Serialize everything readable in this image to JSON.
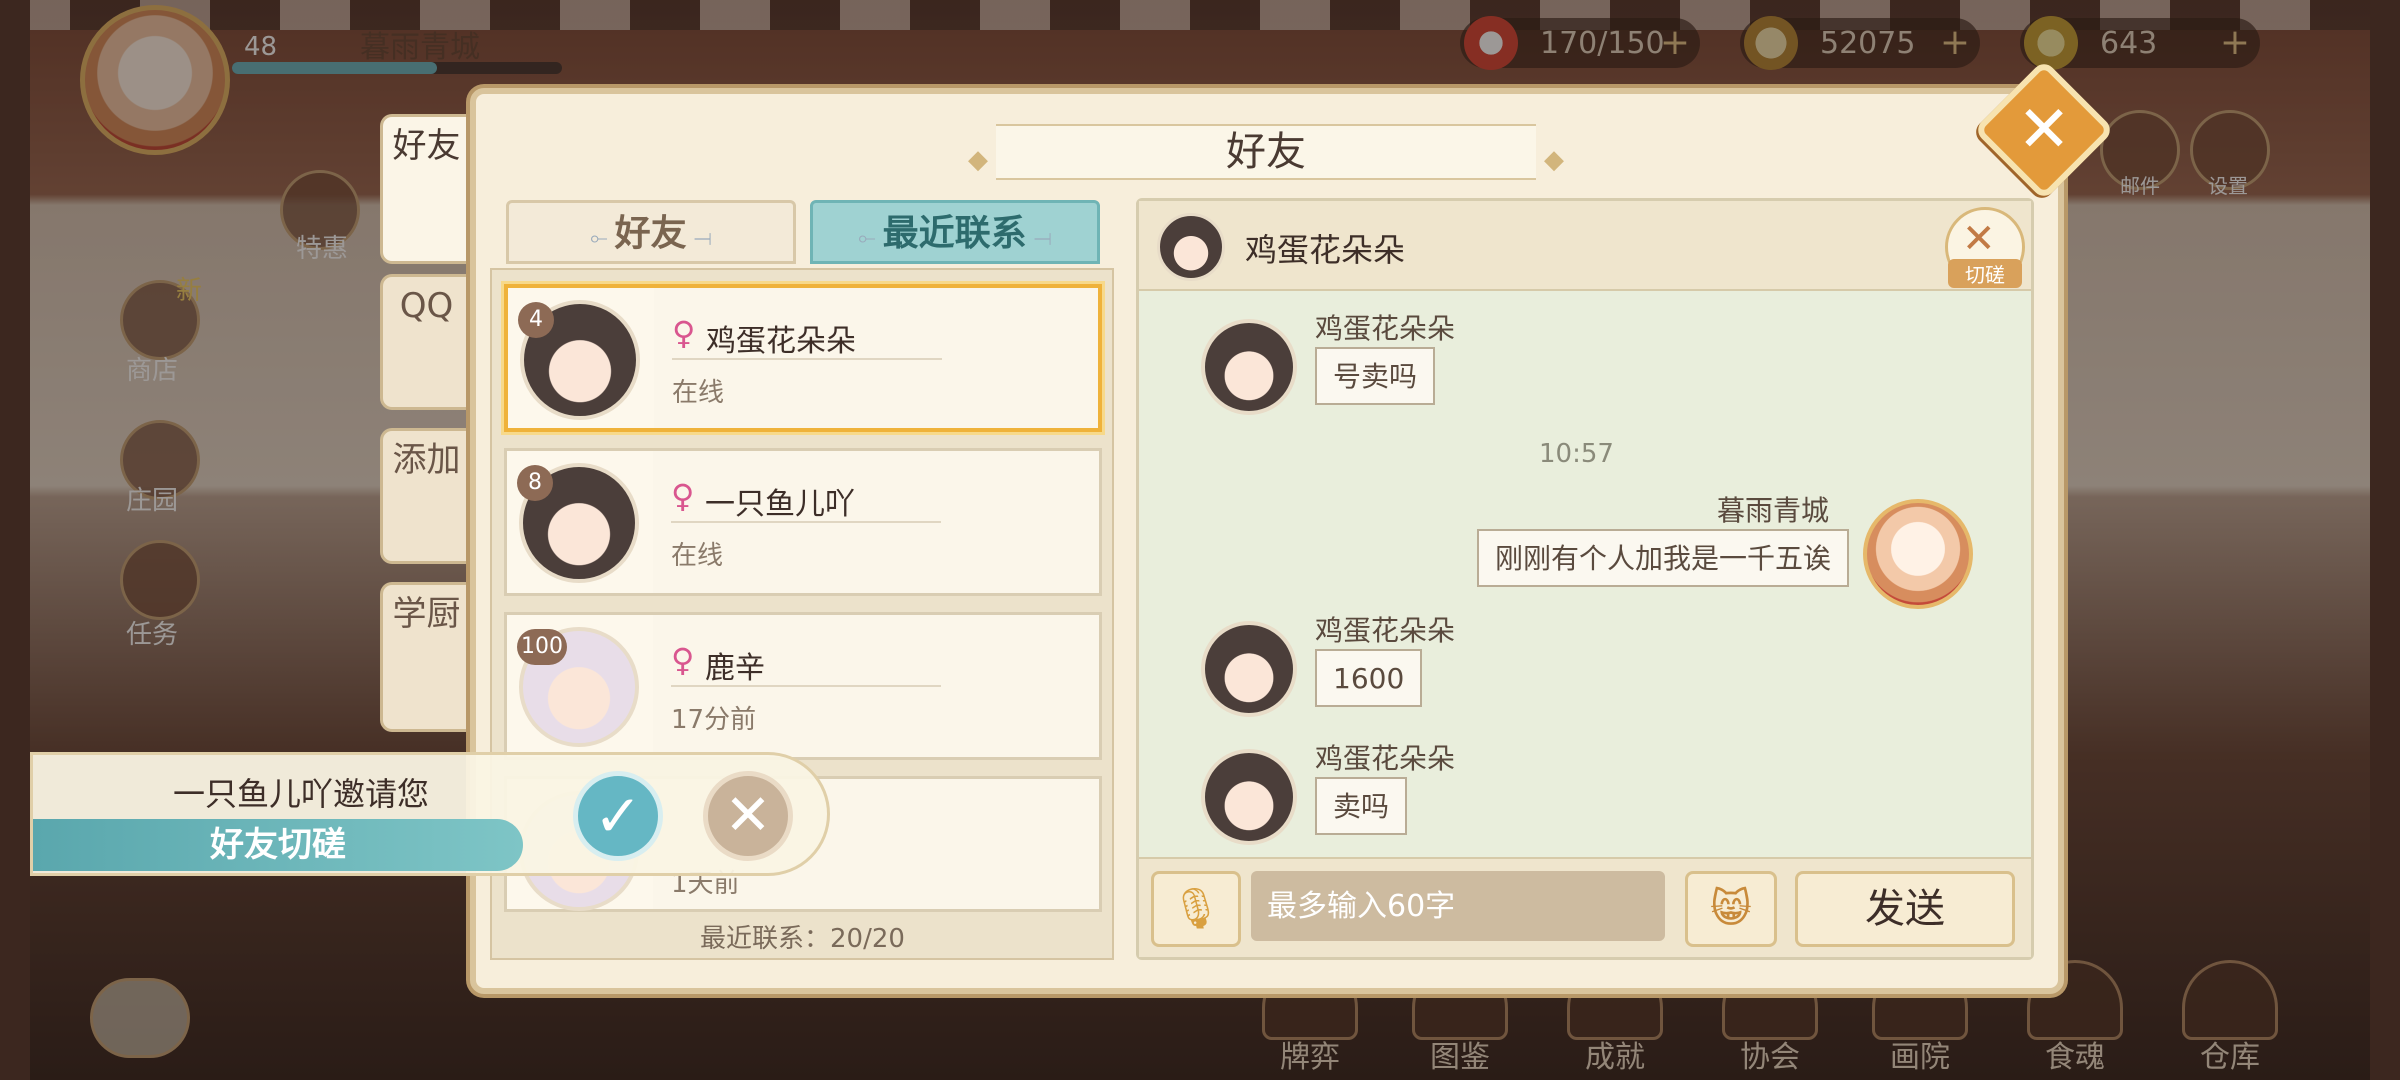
{
  "hud": {
    "player_level": "48",
    "player_name": "暮雨青城",
    "xp_progress": 0.62,
    "stamina": "170/150",
    "coins": "52075",
    "gems": "643",
    "plus": "+"
  },
  "side_menu": [
    {
      "label": "特惠"
    },
    {
      "label": "商店"
    },
    {
      "label": "新"
    },
    {
      "label": "庄园"
    },
    {
      "label": "任务"
    }
  ],
  "right_menu": [
    {
      "label": "邮件"
    },
    {
      "label": "设置"
    }
  ],
  "bottom_menu": [
    {
      "label": "牌弈"
    },
    {
      "label": "图鉴"
    },
    {
      "label": "成就"
    },
    {
      "label": "协会"
    },
    {
      "label": "画院"
    },
    {
      "label": "食魂"
    },
    {
      "label": "仓库"
    }
  ],
  "panel": {
    "title": "好友",
    "close": "✕"
  },
  "vertical_tabs": [
    {
      "label": "好友"
    },
    {
      "label": "QQ"
    },
    {
      "label": "添加"
    },
    {
      "label": "学厨"
    }
  ],
  "list_tabs": {
    "friends": "好友",
    "recent": "最近联系"
  },
  "friends": [
    {
      "level": "4",
      "name": "鸡蛋花朵朵",
      "status": "在线"
    },
    {
      "level": "8",
      "name": "一只鱼儿吖",
      "status": "在线"
    },
    {
      "level": "100",
      "name": "鹿辛",
      "status": "17分前"
    },
    {
      "level": "",
      "name": "",
      "status": "1天前"
    }
  ],
  "gender_symbol": "♀",
  "list_footer": "最近联系：20/20",
  "invite": {
    "text": "一只鱼儿吖邀请您",
    "banner": "好友切磋",
    "accept": "✓",
    "decline": "✕"
  },
  "chat": {
    "partner_name": "鸡蛋花朵朵",
    "spar_label": "切磋",
    "timestamp": "10:57",
    "messages": [
      {
        "from": "鸡蛋花朵朵",
        "text": "号卖吗",
        "self": false
      },
      {
        "from": "暮雨青城",
        "text": "刚刚有个人加我是一千五诶",
        "self": true
      },
      {
        "from": "鸡蛋花朵朵",
        "text": "1600",
        "self": false
      },
      {
        "from": "鸡蛋花朵朵",
        "text": "卖吗",
        "self": false
      }
    ],
    "input_placeholder": "最多输入60字",
    "send_label": "发送"
  }
}
